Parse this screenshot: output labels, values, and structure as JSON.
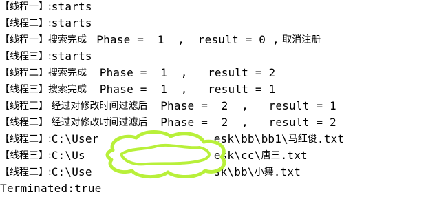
{
  "console": {
    "lines": [
      [
        {
          "t": "【线程一】:",
          "k": "cn"
        },
        {
          "t": "starts",
          "k": "mono"
        }
      ],
      [
        {
          "t": "【线程二】:",
          "k": "cn"
        },
        {
          "t": "starts",
          "k": "mono"
        }
      ],
      [
        {
          "t": "【线程一】搜索完成 ",
          "k": "cn"
        },
        {
          "t": " Phase =  1  ,  result = 0 ,",
          "k": "mono"
        },
        {
          "t": " 取消注册",
          "k": "cn"
        }
      ],
      [
        {
          "t": "【线程三】:",
          "k": "cn"
        },
        {
          "t": "starts",
          "k": "mono"
        }
      ],
      [
        {
          "t": "【线程二】搜索完成  ",
          "k": "cn"
        },
        {
          "t": " Phase =  1  ,   result = 2",
          "k": "mono"
        }
      ],
      [
        {
          "t": "【线程三】搜索完成  ",
          "k": "cn"
        },
        {
          "t": " Phase =  1  ,   result = 1",
          "k": "mono"
        }
      ],
      [
        {
          "t": "【线程三】 经过对修改时间过滤后  ",
          "k": "cn"
        },
        {
          "t": " Phase =  2  ,   result = 1",
          "k": "mono"
        }
      ],
      [
        {
          "t": "【线程二】 经过对修改时间过滤后  ",
          "k": "cn"
        },
        {
          "t": " Phase =  2  ,   result = 2",
          "k": "mono"
        }
      ],
      [
        {
          "t": "【线程二】:",
          "k": "cn"
        },
        {
          "t": "C:\\User",
          "k": "mono"
        },
        {
          "t": "                 ",
          "k": "mono"
        },
        {
          "t": "esk\\bb\\bb1\\",
          "k": "mono"
        },
        {
          "t": "马红俊",
          "k": "cn"
        },
        {
          "t": ".txt",
          "k": "mono"
        }
      ],
      [
        {
          "t": "【线程三】:",
          "k": "cn"
        },
        {
          "t": "C:\\Us",
          "k": "mono"
        },
        {
          "t": "                   ",
          "k": "mono"
        },
        {
          "t": "esk\\cc\\",
          "k": "mono"
        },
        {
          "t": "唐三",
          "k": "cn"
        },
        {
          "t": ".txt",
          "k": "mono"
        }
      ],
      [
        {
          "t": "【线程二】:",
          "k": "cn"
        },
        {
          "t": "C:\\Use",
          "k": "mono"
        },
        {
          "t": "                  ",
          "k": "mono"
        },
        {
          "t": "sk\\bb\\",
          "k": "mono"
        },
        {
          "t": "小舞",
          "k": "cn"
        },
        {
          "t": ".txt",
          "k": "mono"
        }
      ],
      [
        {
          "t": "Terminated:true",
          "k": "mono"
        }
      ]
    ]
  },
  "colors": {
    "background": "#ffffff",
    "text": "#000000",
    "censor": "#b8f03a"
  }
}
